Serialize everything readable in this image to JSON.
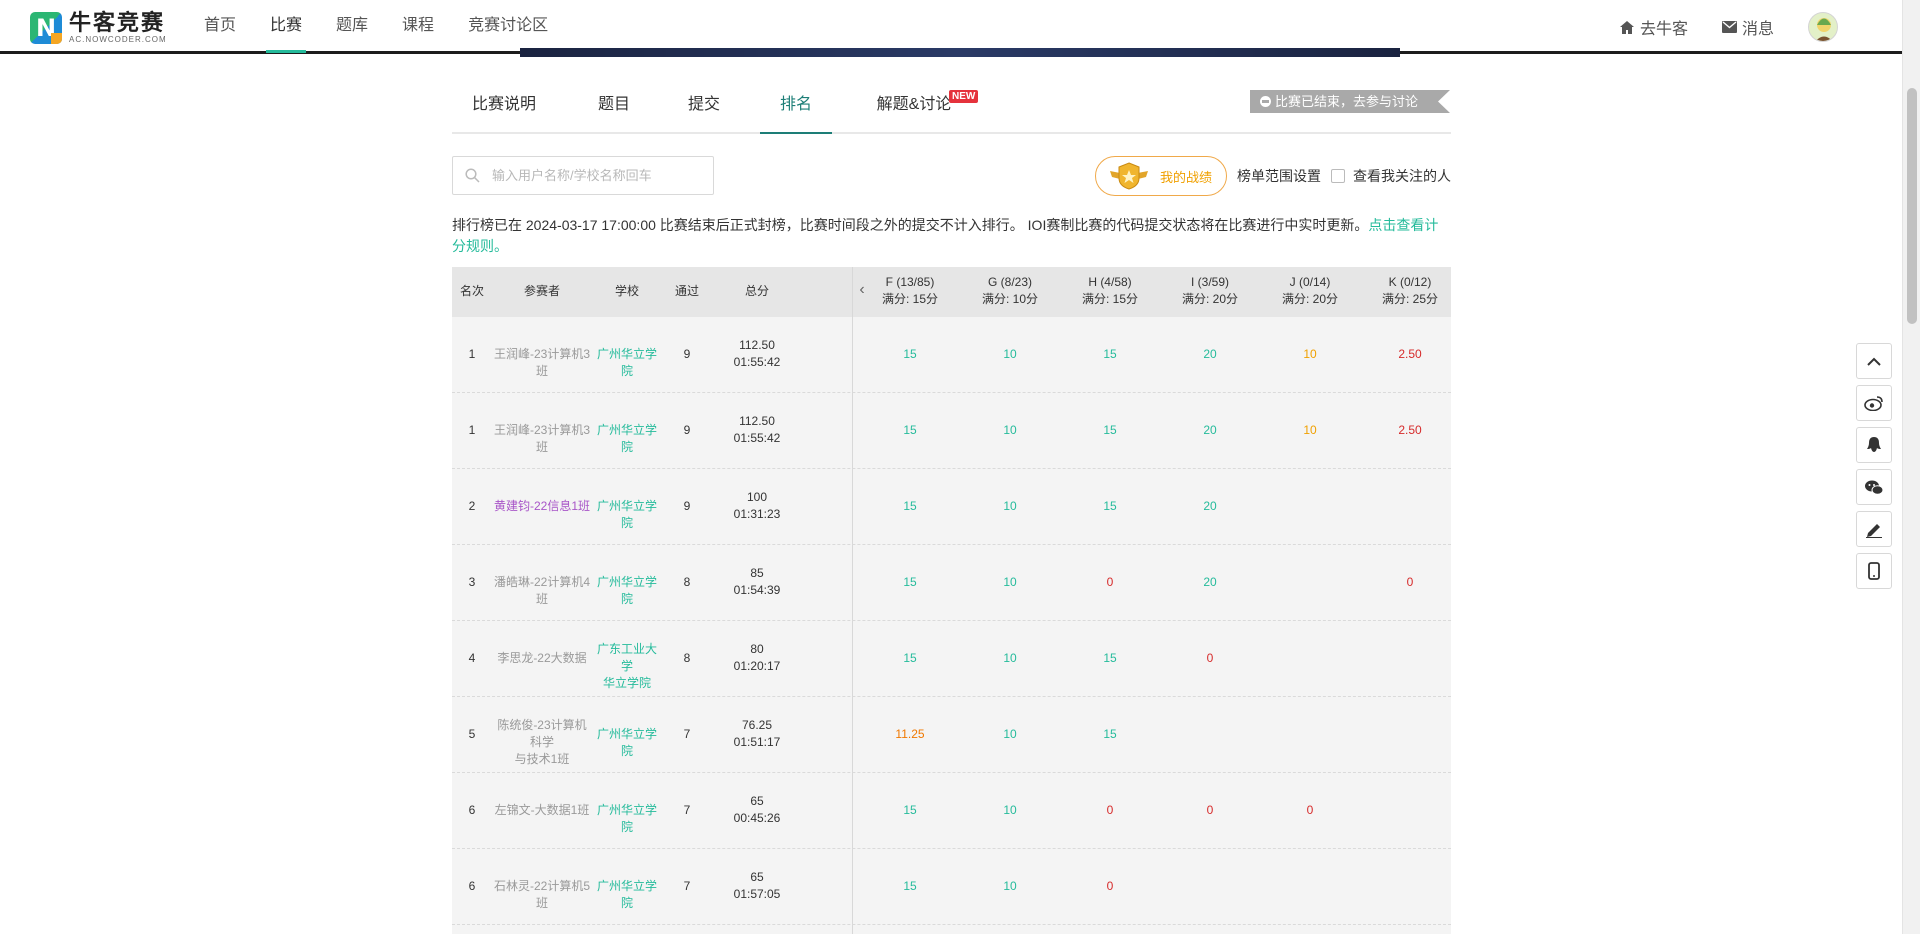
{
  "brand": {
    "name": "牛客竞赛",
    "sub": "AC.NOWCODER.COM",
    "logo_icon": "nowcoder-logo-icon"
  },
  "nav": [
    {
      "label": "首页",
      "active": false
    },
    {
      "label": "比赛",
      "active": true
    },
    {
      "label": "题库",
      "active": false
    },
    {
      "label": "课程",
      "active": false
    },
    {
      "label": "竞赛讨论区",
      "active": false
    }
  ],
  "header_right": {
    "goto_label": "去牛客",
    "goto_icon": "home-icon",
    "msg_label": "消息",
    "msg_icon": "envelope-icon",
    "avatar_icon": "avatar-icon"
  },
  "tabs": [
    {
      "label": "比赛说明",
      "active": false
    },
    {
      "label": "题目",
      "active": false
    },
    {
      "label": "提交",
      "active": false
    },
    {
      "label": "排名",
      "active": true
    },
    {
      "label": "解题&讨论",
      "active": false,
      "badge": "NEW"
    }
  ],
  "ended_banner": "比赛已结束，去参与讨论",
  "search": {
    "placeholder": "输入用户名称/学校名称回车",
    "icon": "search-icon"
  },
  "my_record_label": "我的战绩",
  "range_label": "榜单范围设置",
  "follow_label": "查看我关注的人",
  "notice": {
    "text": "排行榜已在 2024-03-17 17:00:00 比赛结束后正式封榜，比赛时间段之外的提交不计入排行。 IOI赛制比赛的代码提交状态将在比赛进行中实时更新。",
    "link": "点击查看计分规则。"
  },
  "table": {
    "fixed_headers": [
      "名次",
      "参赛者",
      "学校",
      "通过",
      "总分"
    ],
    "problem_headers": [
      {
        "title": "F (13/85)",
        "full": "满分: 15分"
      },
      {
        "title": "G (8/23)",
        "full": "满分: 10分"
      },
      {
        "title": "H (4/58)",
        "full": "满分: 15分"
      },
      {
        "title": "I (3/59)",
        "full": "满分: 20分"
      },
      {
        "title": "J (0/14)",
        "full": "满分: 20分"
      },
      {
        "title": "K (0/12)",
        "full": "满分: 25分"
      }
    ],
    "rows": [
      {
        "rank": "1",
        "name1": "王润峰-23计算机3班",
        "name2": "",
        "name_color": "gray",
        "school1": "广州华立学院",
        "school2": "",
        "passed": "9",
        "score": "112.50",
        "time": "01:55:42",
        "cells": [
          {
            "v": "15",
            "c": "green"
          },
          {
            "v": "10",
            "c": "green"
          },
          {
            "v": "15",
            "c": "green"
          },
          {
            "v": "20",
            "c": "green"
          },
          {
            "v": "10",
            "c": "orange"
          },
          {
            "v": "2.50",
            "c": "red"
          }
        ]
      },
      {
        "rank": "1",
        "name1": "王润峰-23计算机3班",
        "name2": "",
        "name_color": "gray",
        "school1": "广州华立学院",
        "school2": "",
        "passed": "9",
        "score": "112.50",
        "time": "01:55:42",
        "cells": [
          {
            "v": "15",
            "c": "green"
          },
          {
            "v": "10",
            "c": "green"
          },
          {
            "v": "15",
            "c": "green"
          },
          {
            "v": "20",
            "c": "green"
          },
          {
            "v": "10",
            "c": "orange"
          },
          {
            "v": "2.50",
            "c": "red"
          }
        ]
      },
      {
        "rank": "2",
        "name1": "黄建钧-22信息1班",
        "name2": "",
        "name_color": "purple",
        "school1": "广州华立学院",
        "school2": "",
        "passed": "9",
        "score": "100",
        "time": "01:31:23",
        "cells": [
          {
            "v": "15",
            "c": "green"
          },
          {
            "v": "10",
            "c": "green"
          },
          {
            "v": "15",
            "c": "green"
          },
          {
            "v": "20",
            "c": "green"
          },
          {
            "v": "",
            "c": ""
          },
          {
            "v": "",
            "c": ""
          }
        ]
      },
      {
        "rank": "3",
        "name1": "潘皓琳-22计算机4班",
        "name2": "",
        "name_color": "gray",
        "school1": "广州华立学院",
        "school2": "",
        "passed": "8",
        "score": "85",
        "time": "01:54:39",
        "cells": [
          {
            "v": "15",
            "c": "green"
          },
          {
            "v": "10",
            "c": "green"
          },
          {
            "v": "0",
            "c": "red"
          },
          {
            "v": "20",
            "c": "green"
          },
          {
            "v": "",
            "c": ""
          },
          {
            "v": "0",
            "c": "red"
          }
        ]
      },
      {
        "rank": "4",
        "name1": "李思龙-22大数据",
        "name2": "",
        "name_color": "gray",
        "school1": "广东工业大学",
        "school2": "华立学院",
        "passed": "8",
        "score": "80",
        "time": "01:20:17",
        "cells": [
          {
            "v": "15",
            "c": "green"
          },
          {
            "v": "10",
            "c": "green"
          },
          {
            "v": "15",
            "c": "green"
          },
          {
            "v": "0",
            "c": "red"
          },
          {
            "v": "",
            "c": ""
          },
          {
            "v": "",
            "c": ""
          }
        ]
      },
      {
        "rank": "5",
        "name1": "陈统俊-23计算机科学",
        "name2": "与技术1班",
        "name_color": "gray",
        "school1": "广州华立学院",
        "school2": "",
        "passed": "7",
        "score": "76.25",
        "time": "01:51:17",
        "cells": [
          {
            "v": "11.25",
            "c": "partial"
          },
          {
            "v": "10",
            "c": "green"
          },
          {
            "v": "15",
            "c": "green"
          },
          {
            "v": "",
            "c": ""
          },
          {
            "v": "",
            "c": ""
          },
          {
            "v": "",
            "c": ""
          }
        ]
      },
      {
        "rank": "6",
        "name1": "左锦文-大数据1班",
        "name2": "",
        "name_color": "gray",
        "school1": "广州华立学院",
        "school2": "",
        "passed": "7",
        "score": "65",
        "time": "00:45:26",
        "cells": [
          {
            "v": "15",
            "c": "green"
          },
          {
            "v": "10",
            "c": "green"
          },
          {
            "v": "0",
            "c": "red"
          },
          {
            "v": "0",
            "c": "red"
          },
          {
            "v": "0",
            "c": "red"
          },
          {
            "v": "",
            "c": ""
          }
        ]
      },
      {
        "rank": "6",
        "name1": "石林灵-22计算机5班",
        "name2": "",
        "name_color": "gray",
        "school1": "广州华立学院",
        "school2": "",
        "passed": "7",
        "score": "65",
        "time": "01:57:05",
        "cells": [
          {
            "v": "15",
            "c": "green"
          },
          {
            "v": "10",
            "c": "green"
          },
          {
            "v": "0",
            "c": "red"
          },
          {
            "v": "",
            "c": ""
          },
          {
            "v": "",
            "c": ""
          },
          {
            "v": "",
            "c": ""
          }
        ]
      }
    ]
  },
  "side_tools": [
    "chevron-up-icon",
    "weibo-icon",
    "qq-icon",
    "wechat-icon",
    "pencil-icon",
    "mobile-icon"
  ],
  "colors": {
    "accent": "#25bb9b",
    "tab_active": "#1d7e77",
    "orange": "#f0a000",
    "red": "#d62b2b",
    "purple": "#a855c8"
  }
}
